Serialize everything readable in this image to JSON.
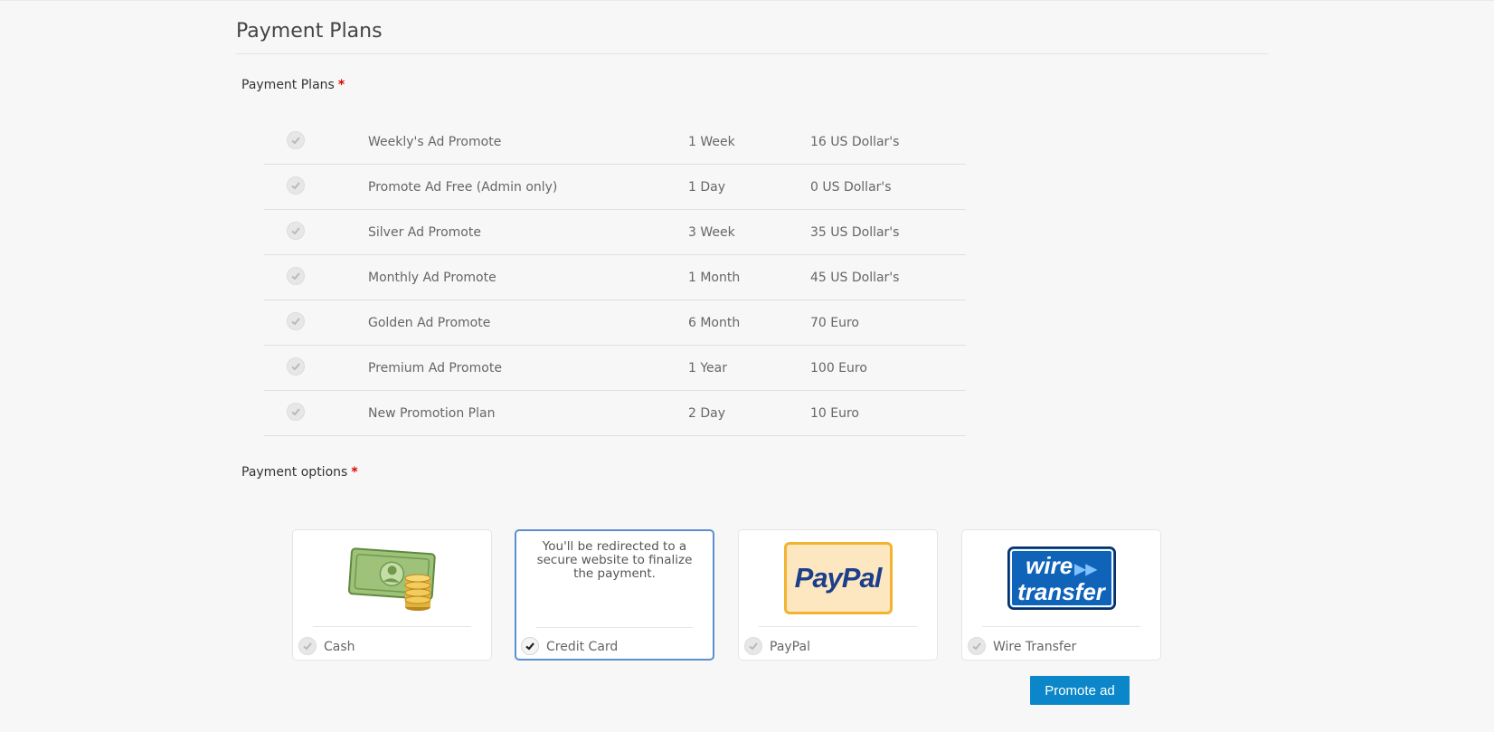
{
  "section_title": "Payment Plans",
  "plans_label": "Payment Plans",
  "required_mark": "*",
  "plans": [
    {
      "name": "Weekly's Ad Promote",
      "duration": "1 Week",
      "price": "16 US Dollar's"
    },
    {
      "name": "Promote Ad Free (Admin only)",
      "duration": "1 Day",
      "price": "0 US Dollar's"
    },
    {
      "name": "Silver Ad Promote",
      "duration": "3 Week",
      "price": "35 US Dollar's"
    },
    {
      "name": "Monthly Ad Promote",
      "duration": "1 Month",
      "price": "45 US Dollar's"
    },
    {
      "name": "Golden Ad Promote",
      "duration": "6 Month",
      "price": "70 Euro"
    },
    {
      "name": "Premium Ad Promote",
      "duration": "1 Year",
      "price": "100 Euro"
    },
    {
      "name": "New Promotion Plan",
      "duration": "2 Day",
      "price": "10 Euro"
    }
  ],
  "options_label": "Payment options",
  "payment_options": [
    {
      "label": "Cash",
      "icon": "cash-icon",
      "selected": false
    },
    {
      "label": "Credit Card",
      "description": "You'll be redirected to a secure website to finalize the payment.",
      "selected": true
    },
    {
      "label": "PayPal",
      "icon": "paypal-logo",
      "logo_text": "PayPal",
      "selected": false
    },
    {
      "label": "Wire Transfer",
      "icon": "wire-transfer-logo",
      "logo_text_1": "wire",
      "logo_text_2": "transfer",
      "selected": false
    }
  ],
  "promote_button": "Promote ad",
  "colors": {
    "accent": "#0b86c9",
    "required": "#e00000",
    "selected_border": "#5b8fd0"
  }
}
